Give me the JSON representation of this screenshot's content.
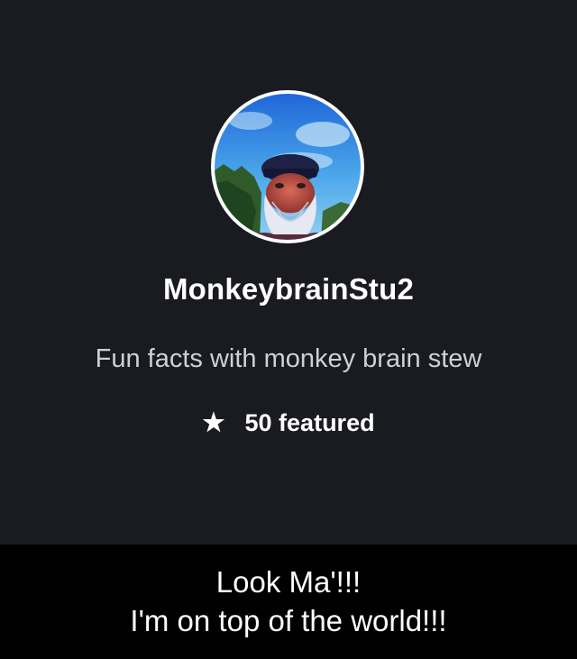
{
  "profile": {
    "avatar_icon": "profile-photo-man-with-cap",
    "username": "MonkeybrainStu2",
    "bio": "Fun facts with monkey brain stew",
    "featured_icon": "star-icon",
    "featured_text": "50 featured"
  },
  "caption": {
    "line1": "Look Ma'!!!",
    "line2": "I'm on top of the world!!!"
  },
  "colors": {
    "card_background": "#1a1b21",
    "caption_background": "#000000",
    "text_primary": "#ffffff",
    "text_secondary": "#cfd0d6"
  }
}
